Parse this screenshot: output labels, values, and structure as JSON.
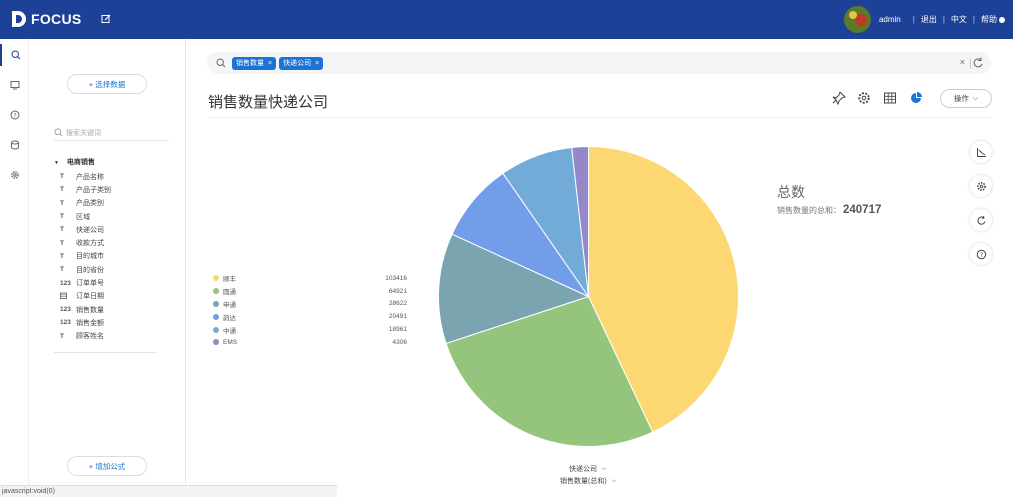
{
  "app": {
    "brand": "FOCUS"
  },
  "topbar": {
    "username": "admin",
    "logout": "退出",
    "language": "中文",
    "help": "帮助"
  },
  "sidebar": {
    "select_data_label": "+ 选择数据",
    "search_placeholder": "搜索关键词",
    "tree_title": "电商销售",
    "fields": [
      {
        "type": "T",
        "name": "产品名称"
      },
      {
        "type": "T",
        "name": "产品子类别"
      },
      {
        "type": "T",
        "name": "产品类别"
      },
      {
        "type": "T",
        "name": "区域"
      },
      {
        "type": "T",
        "name": "快递公司"
      },
      {
        "type": "T",
        "name": "收款方式"
      },
      {
        "type": "T",
        "name": "目的城市"
      },
      {
        "type": "T",
        "name": "目的省份"
      },
      {
        "type": "123",
        "name": "订单单号"
      },
      {
        "type": "date",
        "name": "订单日期"
      },
      {
        "type": "123",
        "name": "销售数量"
      },
      {
        "type": "123",
        "name": "销售金额"
      },
      {
        "type": "T",
        "name": "顾客姓名"
      }
    ],
    "add_formula_label": "+ 增加公式"
  },
  "query": {
    "chips": [
      {
        "label": "销售数量",
        "close": "×"
      },
      {
        "label": "快递公司",
        "close": "×"
      }
    ],
    "clear": "×"
  },
  "main": {
    "title": "销售数量快递公司",
    "ops_label": "操作"
  },
  "stat": {
    "title": "总数",
    "label": "销售数量的总和：",
    "value": "240717"
  },
  "axis": {
    "x_selector": "快递公司",
    "y_selector": "销售数量(总和)"
  },
  "statusbar": {
    "text": "javascript:void(0)"
  },
  "colors": {
    "topbar": "#1d4196",
    "accent": "#1d73d3"
  },
  "chart_data": {
    "type": "pie",
    "categories": [
      "顺丰",
      "圆通",
      "申通",
      "韵达",
      "中通",
      "EMS"
    ],
    "values": [
      103416,
      64921,
      28622,
      20491,
      18961,
      4306
    ],
    "colors": [
      "#fcd772",
      "#95c57c",
      "#7aa5b0",
      "#729de9",
      "#72aad8",
      "#9488c9"
    ],
    "xlabel": "快递公司",
    "ylabel": "销售数量(总和)",
    "legend_position": "left"
  }
}
